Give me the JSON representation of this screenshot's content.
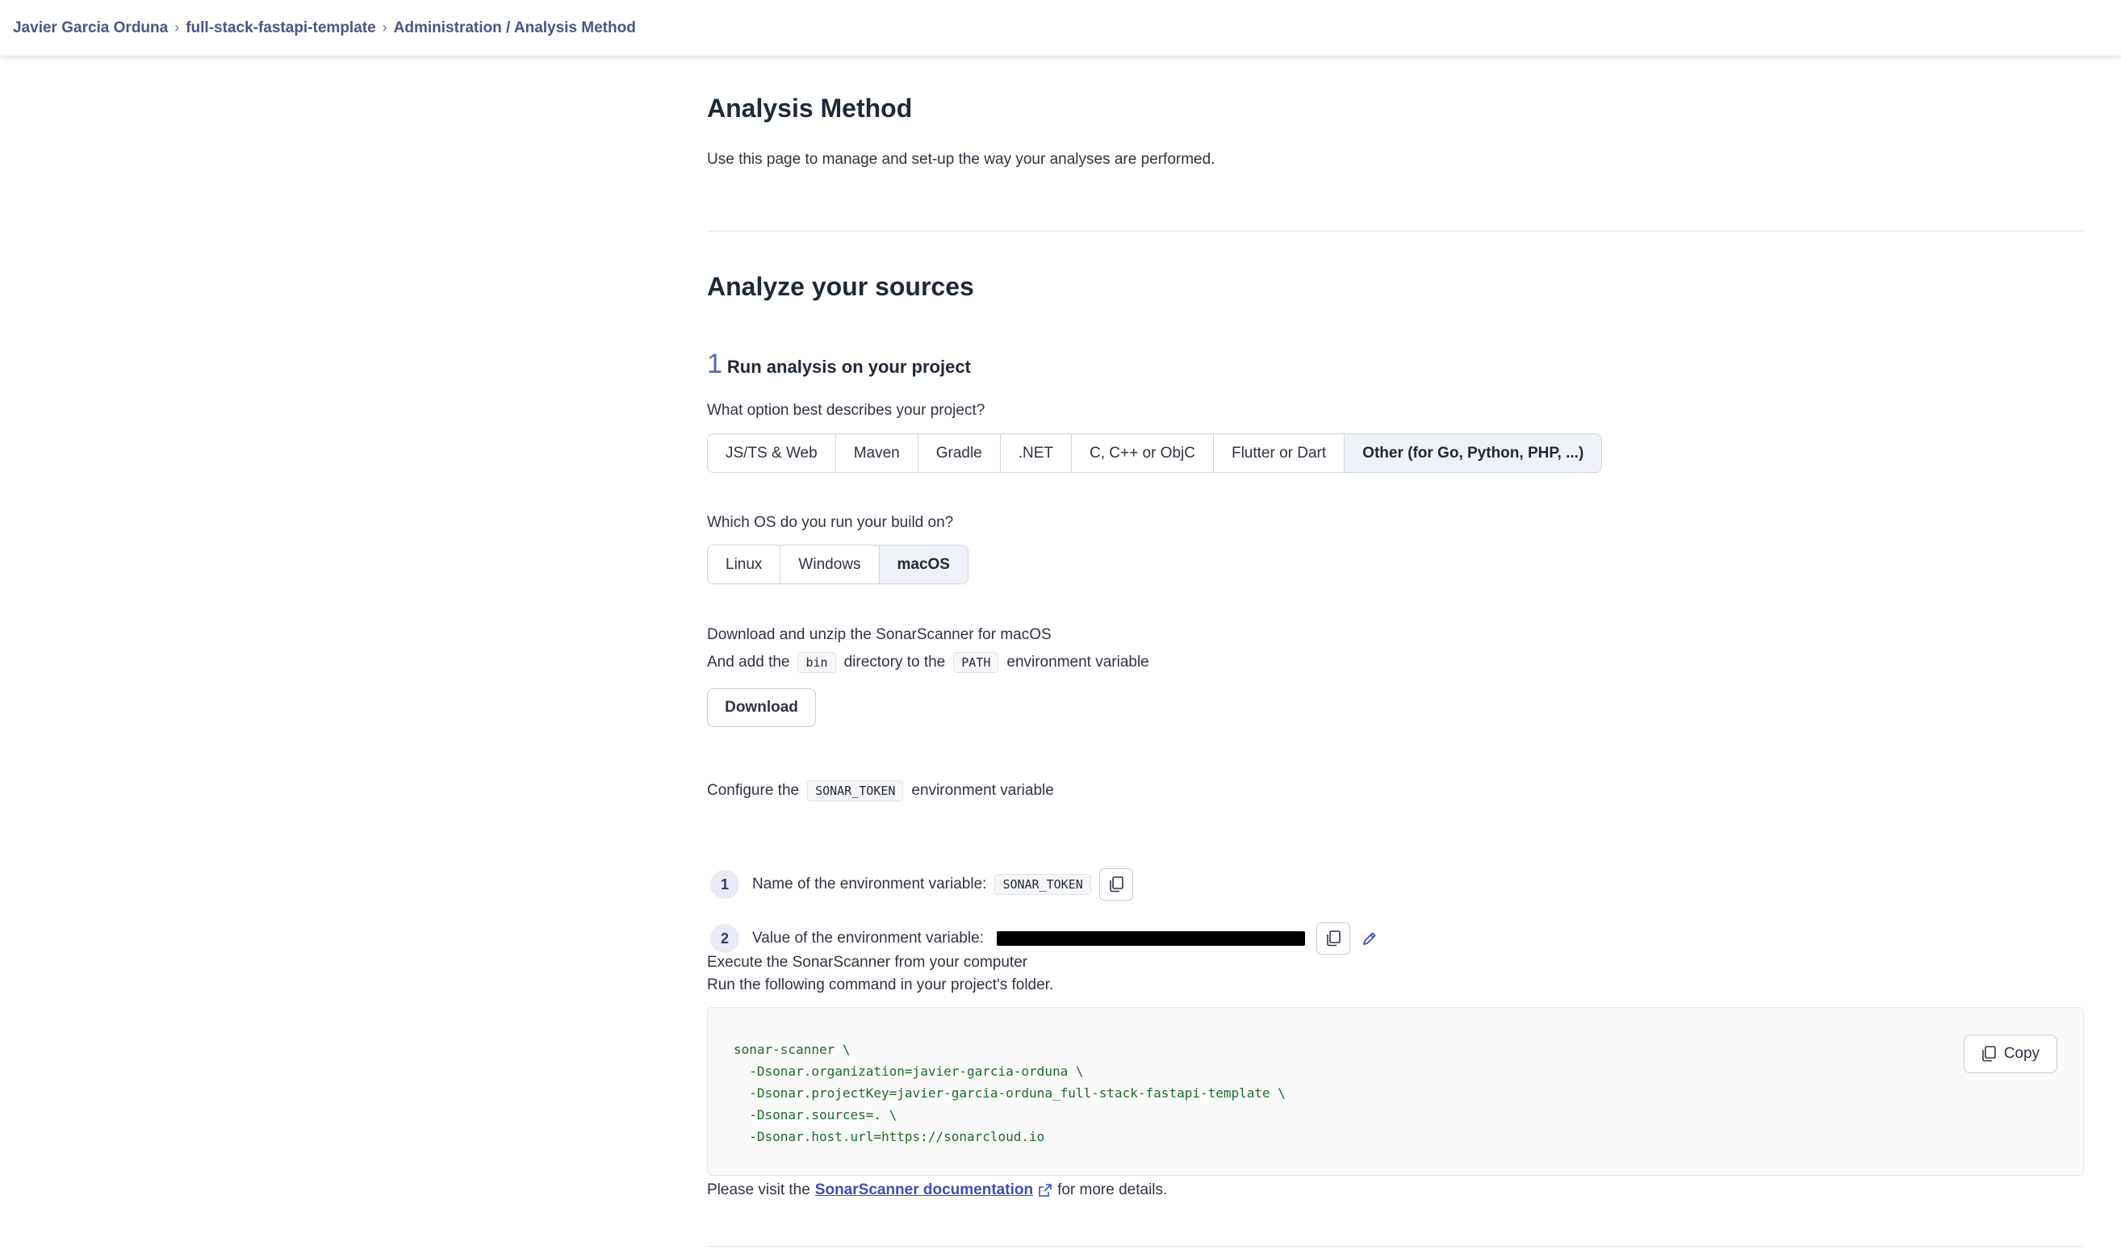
{
  "breadcrumb": {
    "items": [
      "Javier Garcia Orduna",
      "full-stack-fastapi-template",
      "Administration / Analysis Method"
    ]
  },
  "page": {
    "title": "Analysis Method",
    "description": "Use this page to manage and set-up the way your analyses are performed.",
    "section_title": "Analyze your sources"
  },
  "step": {
    "number": "1",
    "title": "Run analysis on your project"
  },
  "project_question": "What option best describes your project?",
  "project_options": [
    {
      "label": "JS/TS & Web",
      "selected": false
    },
    {
      "label": "Maven",
      "selected": false
    },
    {
      "label": "Gradle",
      "selected": false
    },
    {
      "label": ".NET",
      "selected": false
    },
    {
      "label": "C, C++ or ObjC",
      "selected": false
    },
    {
      "label": "Flutter or Dart",
      "selected": false
    },
    {
      "label": "Other (for Go, Python, PHP, ...)",
      "selected": true
    }
  ],
  "os_question": "Which OS do you run your build on?",
  "os_options": [
    {
      "label": "Linux",
      "selected": false
    },
    {
      "label": "Windows",
      "selected": false
    },
    {
      "label": "macOS",
      "selected": true
    }
  ],
  "download": {
    "line1": "Download and unzip the SonarScanner for macOS",
    "line2_prefix": "And add the",
    "chip1": "bin",
    "line2_middle": "directory to the",
    "chip2": "PATH",
    "line2_suffix": "environment variable",
    "button": "Download"
  },
  "token": {
    "configure_prefix": "Configure the",
    "configure_chip": "SONAR_TOKEN",
    "configure_suffix": "environment variable",
    "item1_number": "1",
    "item1_label": "Name of the environment variable:",
    "item1_value": "SONAR_TOKEN",
    "item2_number": "2",
    "item2_label": "Value of the environment variable:"
  },
  "execute": {
    "line1": "Execute the SonarScanner from your computer",
    "line2": "Run the following command in your project's folder.",
    "code": "sonar-scanner \\\n  -Dsonar.organization=javier-garcia-orduna \\\n  -Dsonar.projectKey=javier-garcia-orduna_full-stack-fastapi-template \\\n  -Dsonar.sources=. \\\n  -Dsonar.host.url=https://sonarcloud.io",
    "copy_label": "Copy"
  },
  "footer": {
    "prefix": "Please visit the",
    "link": "SonarScanner documentation",
    "suffix": "for more details."
  },
  "colors": {
    "accent": "#3b4fb8",
    "selected_bg": "#eef1f8",
    "code_green": "#1d6b2a"
  }
}
